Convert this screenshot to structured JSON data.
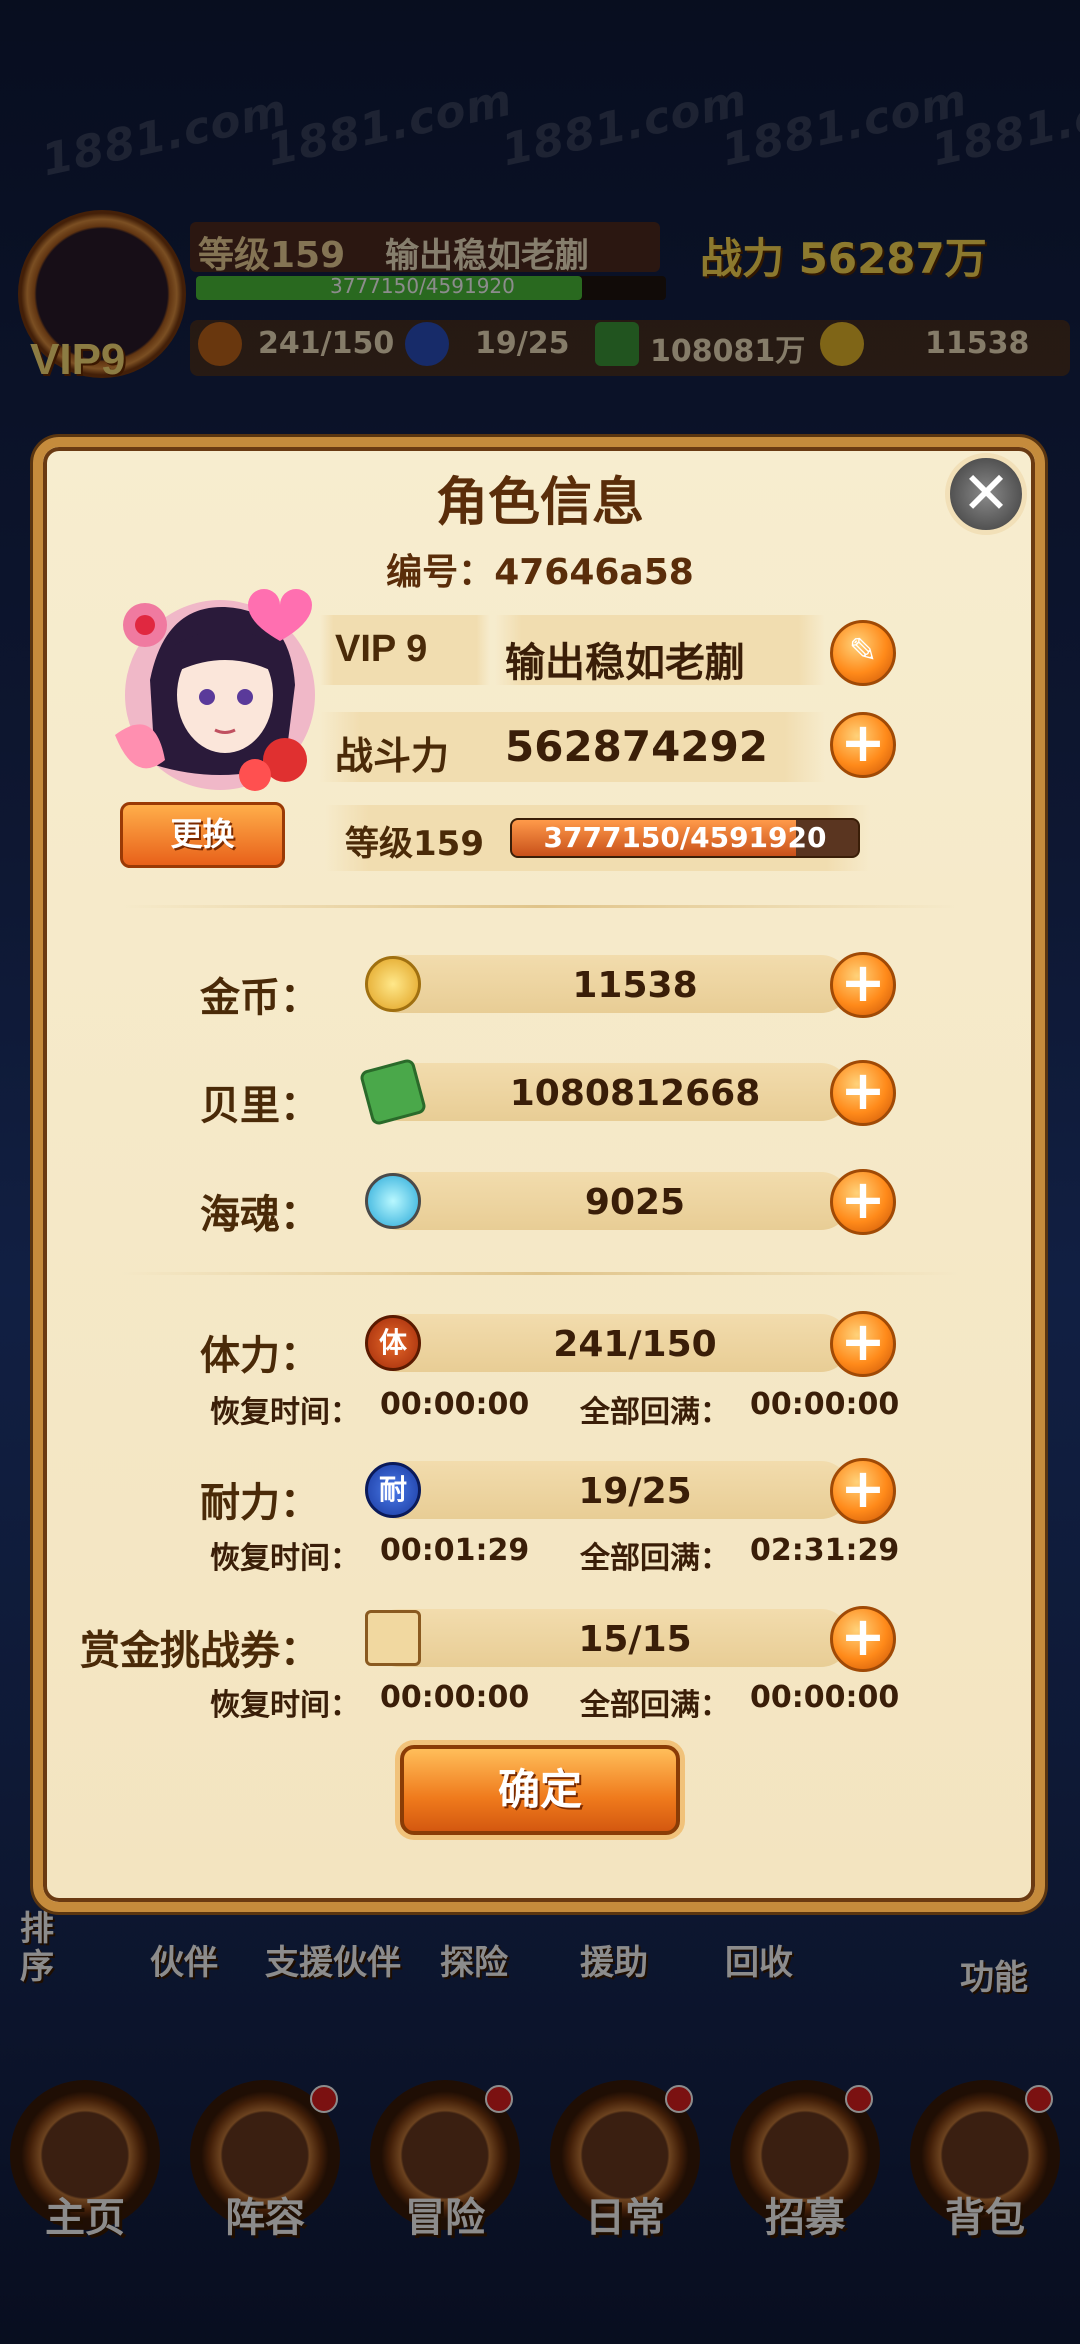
{
  "watermark": "1881.com",
  "hud": {
    "level": "等级159",
    "name": "输出稳如老蒯",
    "exp": "3777150/4591920",
    "exp_ratio": 0.822,
    "vip": "VIP9",
    "power_label": "战力",
    "power": "56287万",
    "stamina": "241/150",
    "endurance": "19/25",
    "berry": "108081万",
    "gold": "11538"
  },
  "subnav": [
    "伙伴",
    "支援伙伴",
    "探险",
    "援助",
    "回收",
    "功能"
  ],
  "sort_label": "排序",
  "bottom_nav": [
    "主页",
    "阵容",
    "冒险",
    "日常",
    "招募",
    "背包"
  ],
  "dialog": {
    "title": "角色信息",
    "close_glyph": "✕",
    "id_label": "编号：",
    "id_value": "47646a58",
    "vip": "VIP 9",
    "name": "输出稳如老蒯",
    "power_label": "战斗力",
    "power_value": "562874292",
    "change_button": "更换",
    "level_label": "等级159",
    "exp_text": "3777150/4591920",
    "exp_ratio": 0.822,
    "plus_glyph": "+",
    "resources": [
      {
        "label": "金币：",
        "value": "11538",
        "icon": "gold-coin-icon"
      },
      {
        "label": "贝里：",
        "value": "1080812668",
        "icon": "cash-icon"
      },
      {
        "label": "海魂：",
        "value": "9025",
        "icon": "sea-soul-icon"
      }
    ],
    "energies": [
      {
        "label": "体力：",
        "value": "241/150",
        "icon_char": "体",
        "recover_label": "恢复时间：",
        "recover": "00:00:00",
        "full_label": "全部回满：",
        "full": "00:00:00"
      },
      {
        "label": "耐力：",
        "value": "19/25",
        "icon_char": "耐",
        "recover_label": "恢复时间：",
        "recover": "00:01:29",
        "full_label": "全部回满：",
        "full": "02:31:29"
      },
      {
        "label": "赏金挑战券：",
        "value": "15/15",
        "icon_char": "",
        "recover_label": "恢复时间：",
        "recover": "00:00:00",
        "full_label": "全部回满：",
        "full": "00:00:00"
      }
    ],
    "confirm": "确定"
  },
  "colors": {
    "accent": "#ff8a1a",
    "frame": "#c58b3c",
    "panel": "#f7edcf",
    "text": "#4a2a08"
  }
}
